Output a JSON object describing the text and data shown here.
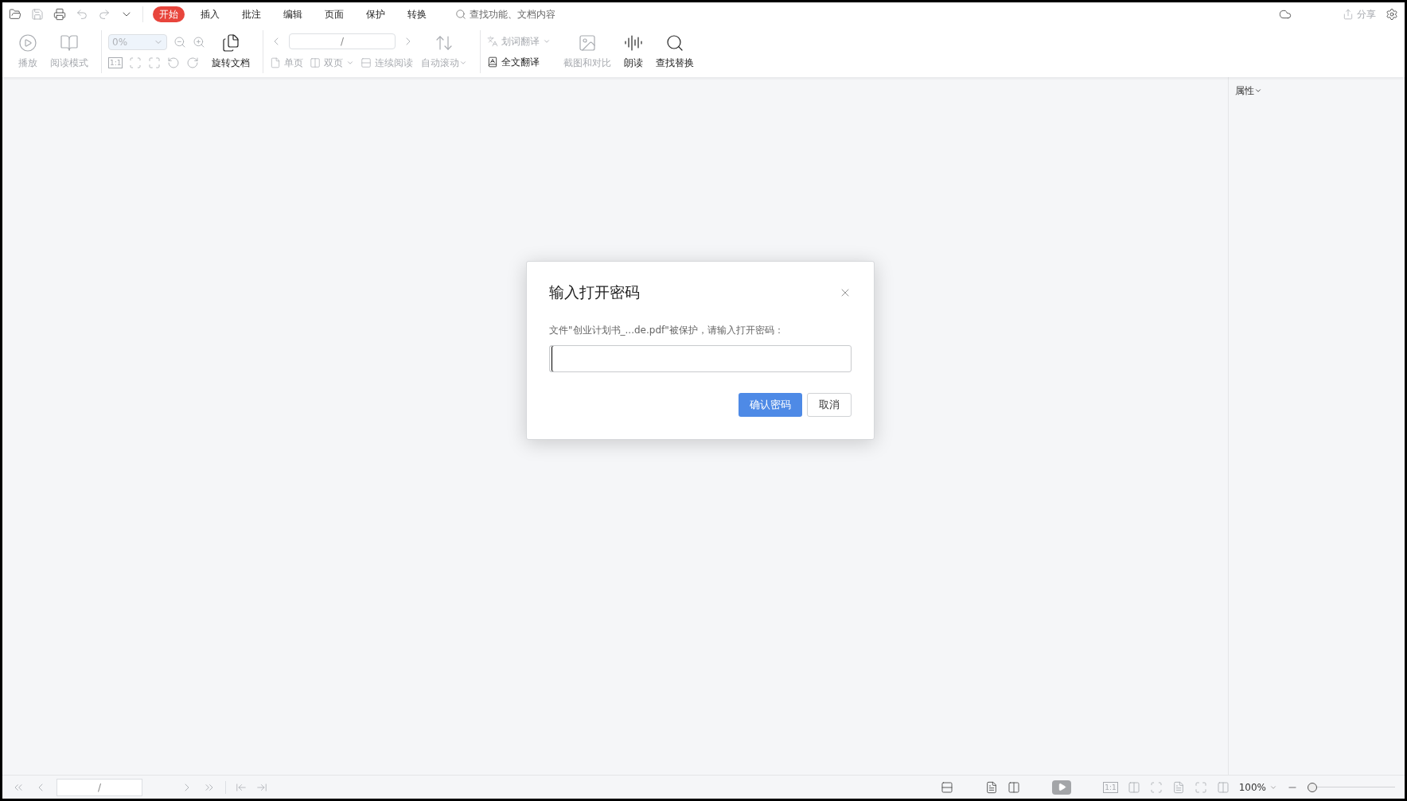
{
  "menu_tabs": [
    {
      "label": "开始",
      "selected": true
    },
    {
      "label": "插入",
      "selected": false
    },
    {
      "label": "批注",
      "selected": false
    },
    {
      "label": "编辑",
      "selected": false
    },
    {
      "label": "页面",
      "selected": false
    },
    {
      "label": "保护",
      "selected": false
    },
    {
      "label": "转换",
      "selected": false
    }
  ],
  "search": {
    "placeholder": "查找功能、文档内容"
  },
  "share": {
    "label": "分享",
    "disabled": true
  },
  "toolbar": {
    "play": {
      "label": "播放",
      "disabled": true
    },
    "reading_mode": {
      "label": "阅读模式",
      "disabled": true
    },
    "zoom_field": {
      "value": "0%",
      "disabled": true
    },
    "actual_size_label": "1:1",
    "rotate_document": {
      "label": "旋转文档",
      "disabled": false
    },
    "page_field": {
      "value": "/"
    },
    "view_modes": [
      {
        "label": "单页",
        "disabled": true,
        "dropdown": false
      },
      {
        "label": "双页",
        "disabled": true,
        "dropdown": true
      },
      {
        "label": "连续阅读",
        "disabled": true,
        "dropdown": false
      }
    ],
    "auto_scroll": {
      "label": "自动滚动",
      "disabled": true,
      "dropdown": true
    },
    "word_translate": {
      "label": "划词翻译",
      "disabled": true,
      "dropdown": true
    },
    "full_translate": {
      "label": "全文翻译",
      "disabled": false
    },
    "big_buttons": [
      {
        "kind": "screenshot",
        "label": "截图和对比",
        "disabled": true
      },
      {
        "kind": "read",
        "label": "朗读",
        "disabled": false
      },
      {
        "kind": "find",
        "label": "查找替换",
        "disabled": false
      }
    ]
  },
  "side_panel": {
    "title": "属性"
  },
  "dialog": {
    "title": "输入打开密码",
    "message": "文件\"创业计划书_...de.pdf\"被保护，请输入打开密码：",
    "password_field": {
      "focused": true
    },
    "buttons": [
      {
        "kind": "primary",
        "label": "确认密码"
      },
      {
        "kind": "secondary",
        "label": "取消"
      }
    ]
  },
  "status_bar": {
    "page_field": {
      "value": "/"
    },
    "actual_size_label": "1:1",
    "zoom": "100%",
    "zoom_slider": {
      "level": 0
    }
  }
}
